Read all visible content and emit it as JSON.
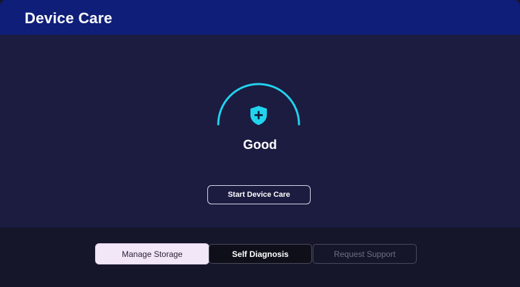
{
  "header": {
    "title": "Device Care"
  },
  "status": {
    "label": "Good",
    "shield_icon": "shield-plus-icon",
    "accent": "#22d3ee"
  },
  "actions": {
    "start_label": "Start Device Care"
  },
  "nav": {
    "items": [
      {
        "label": "Manage Storage",
        "state": "focused"
      },
      {
        "label": "Self Diagnosis",
        "state": "normal"
      },
      {
        "label": "Request Support",
        "state": "disabled"
      }
    ]
  },
  "colors": {
    "header_bg": "#0f1e78",
    "main_bg": "#1b1c40",
    "footer_bg": "#15162a",
    "focused_button_bg": "#f1e7f6"
  }
}
